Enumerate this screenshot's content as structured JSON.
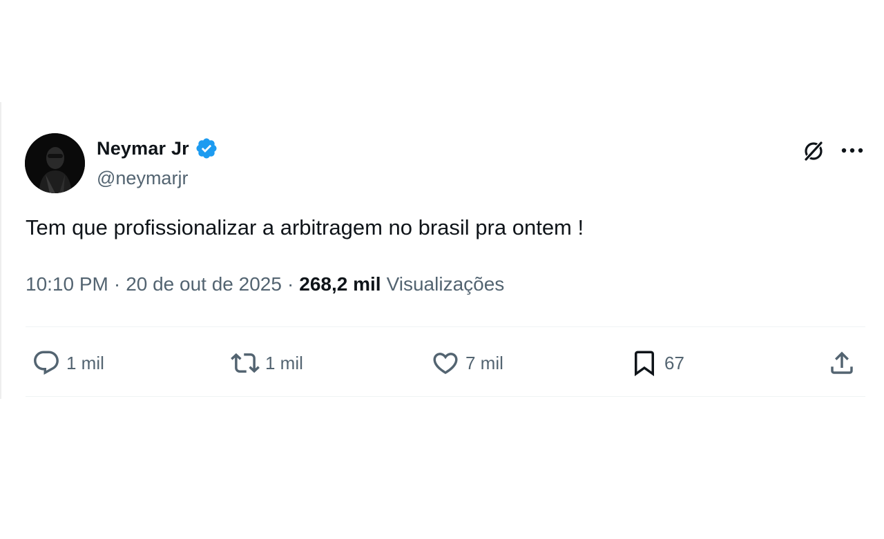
{
  "author": {
    "display_name": "Neymar Jr",
    "handle": "@neymarjr",
    "verified": true
  },
  "tweet": {
    "text": "Tem que profissionalizar a arbitragem no brasil pra ontem !",
    "time": "10:10 PM",
    "date": "20 de out de 2025",
    "views_count": "268,2 mil",
    "views_label": "Visualizações",
    "separator": "·"
  },
  "actions": {
    "replies": "1 mil",
    "retweets": "1 mil",
    "likes": "7 mil",
    "bookmarks": "67"
  },
  "colors": {
    "text_primary": "#0f1419",
    "text_secondary": "#536471",
    "verified_badge": "#1d9bf0",
    "divider": "#eff3f4"
  },
  "icons": {
    "verified": "verified-badge-icon",
    "grok": "grok-icon",
    "more": "more-horizontal-icon",
    "reply": "reply-icon",
    "retweet": "retweet-icon",
    "like": "heart-icon",
    "bookmark": "bookmark-icon",
    "share": "share-icon"
  }
}
